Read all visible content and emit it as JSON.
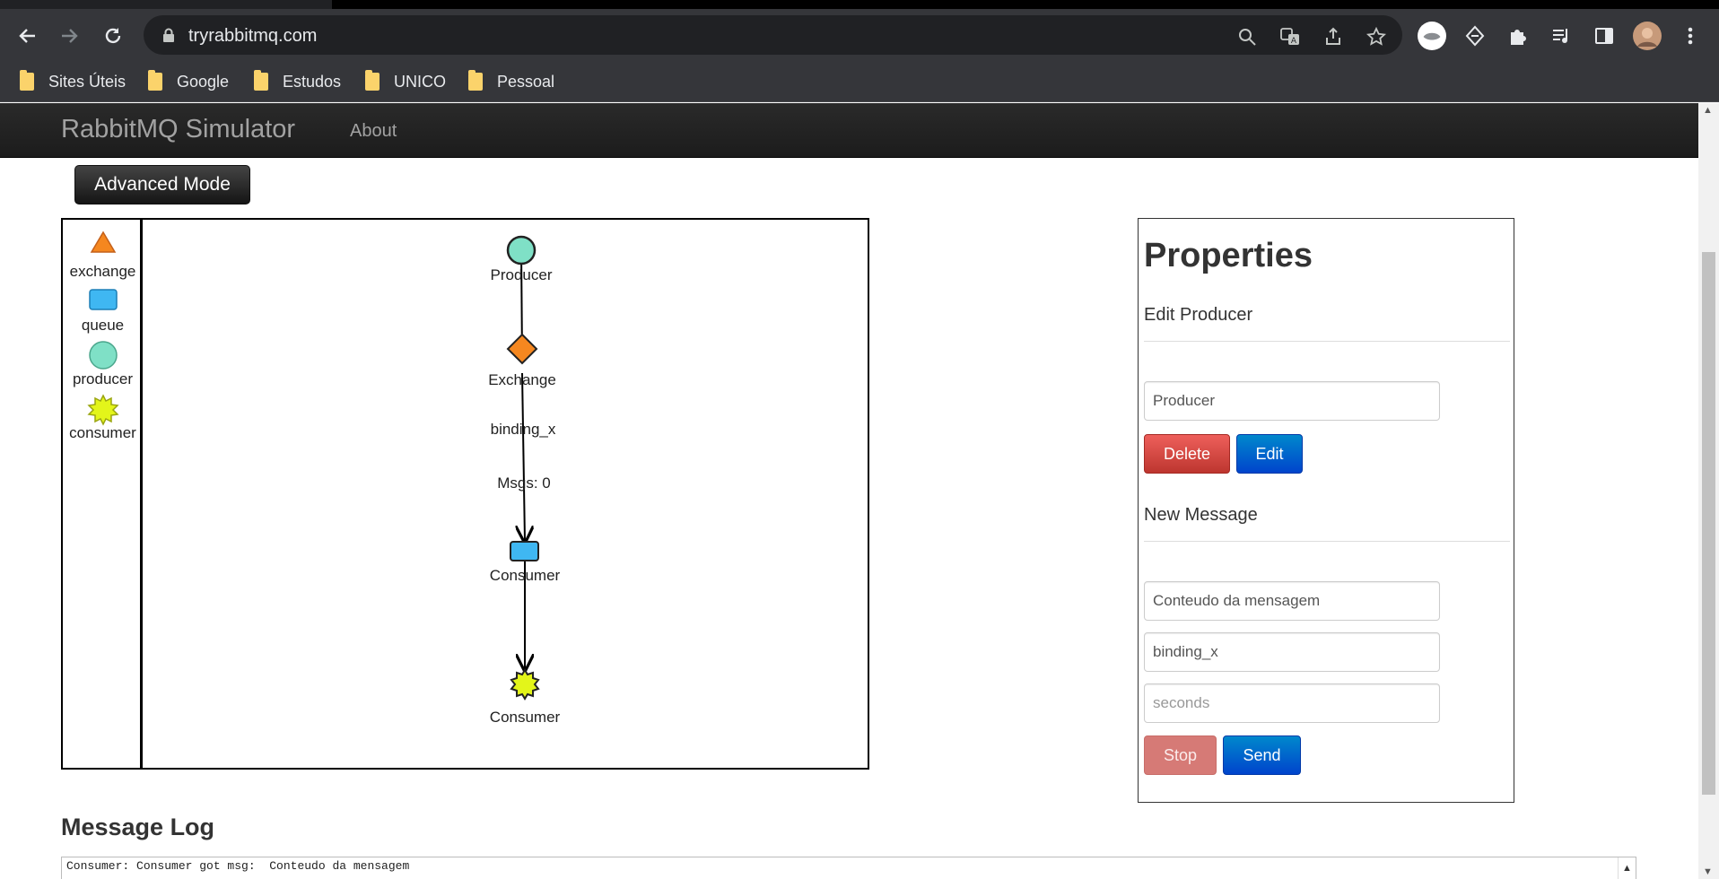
{
  "browser": {
    "url": "tryrabbitmq.com",
    "bookmarks": [
      "Sites Úteis",
      "Google",
      "Estudos",
      "UNICO",
      "Pessoal"
    ],
    "icons": [
      "back-icon",
      "forward-icon",
      "reload-icon",
      "lock-icon",
      "search-icon",
      "translate-icon",
      "share-icon",
      "star-icon",
      "profile-extension-icon",
      "extension-diamond-icon",
      "puzzle-icon",
      "media-icon",
      "sidepanel-icon",
      "avatar",
      "menu-icon"
    ]
  },
  "navbar": {
    "brand": "RabbitMQ Simulator",
    "about": "About"
  },
  "advanced_mode_label": "Advanced Mode",
  "palette": {
    "exchange": "exchange",
    "queue": "queue",
    "producer": "producer",
    "consumer": "consumer"
  },
  "diagram": {
    "producer_label": "Producer",
    "exchange_label": "Exchange",
    "binding_label": "binding_x",
    "msgs_label": "Msgs: 0",
    "queue_label": "Consumer",
    "consumer_label": "Consumer",
    "colors": {
      "exchange": "#f5871f",
      "queue": "#3fb7f2",
      "producer": "#7fe0c6",
      "consumer": "#e3f51a"
    }
  },
  "properties": {
    "title": "Properties",
    "edit_section": "Edit Producer",
    "producer_name_value": "Producer",
    "delete_label": "Delete",
    "edit_label": "Edit",
    "new_message_section": "New Message",
    "message_value": "Conteudo da mensagem",
    "routing_key_value": "binding_x",
    "seconds_placeholder": "seconds",
    "stop_label": "Stop",
    "send_label": "Send"
  },
  "log": {
    "title": "Message Log",
    "lines": [
      "Consumer: Consumer got msg:  Conteudo da mensagem"
    ]
  }
}
